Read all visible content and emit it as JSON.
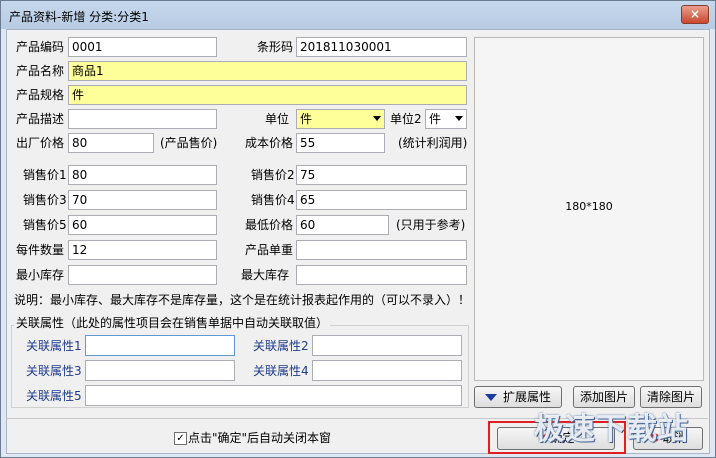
{
  "window": {
    "title": "产品资料-新增 分类:分类1",
    "close": "×"
  },
  "fields": {
    "code_label": "产品编码",
    "code_value": "0001",
    "barcode_label": "条形码",
    "barcode_value": "201811030001",
    "name_label": "产品名称",
    "name_value": "商品1",
    "spec_label": "产品规格",
    "spec_value": "件",
    "desc_label": "产品描述",
    "desc_value": "",
    "unit_label": "单位",
    "unit_value": "件",
    "unit2_label": "单位2",
    "unit2_value": "件",
    "factory_price_label": "出厂价格",
    "factory_price_value": "80",
    "factory_price_note": "(产品售价)",
    "cost_price_label": "成本价格",
    "cost_price_value": "55",
    "cost_price_note": "(统计利润用)",
    "sale1_label": "销售价1",
    "sale1_value": "80",
    "sale2_label": "销售价2",
    "sale2_value": "75",
    "sale3_label": "销售价3",
    "sale3_value": "70",
    "sale4_label": "销售价4",
    "sale4_value": "65",
    "sale5_label": "销售价5",
    "sale5_value": "60",
    "min_price_label": "最低价格",
    "min_price_value": "60",
    "min_price_note": "(只用于参考)",
    "qty_label": "每件数量",
    "qty_value": "12",
    "weight_label": "产品单重",
    "weight_value": "",
    "min_stock_label": "最小库存",
    "min_stock_value": "",
    "max_stock_label": "最大库存",
    "max_stock_value": ""
  },
  "note": "说明：最小库存、最大库存不是库存量，这个是在统计报表起作用的（可以不录入）！",
  "related": {
    "legend": "关联属性（此处的属性项目会在销售单据中自动关联取值）",
    "attr1": "关联属性1",
    "attr2": "关联属性2",
    "attr3": "关联属性3",
    "attr4": "关联属性4",
    "attr5": "关联属性5"
  },
  "preview": {
    "size_text": "180*180"
  },
  "buttons": {
    "extend": "扩展属性",
    "add_image": "添加图片",
    "clear_image": "清除图片",
    "ok": "确定",
    "cancel": "取消"
  },
  "footer": {
    "auto_close_label": "点击\"确定\"后自动关闭本窗",
    "auto_close_checked": "✓"
  },
  "watermark": "极速下载站"
}
